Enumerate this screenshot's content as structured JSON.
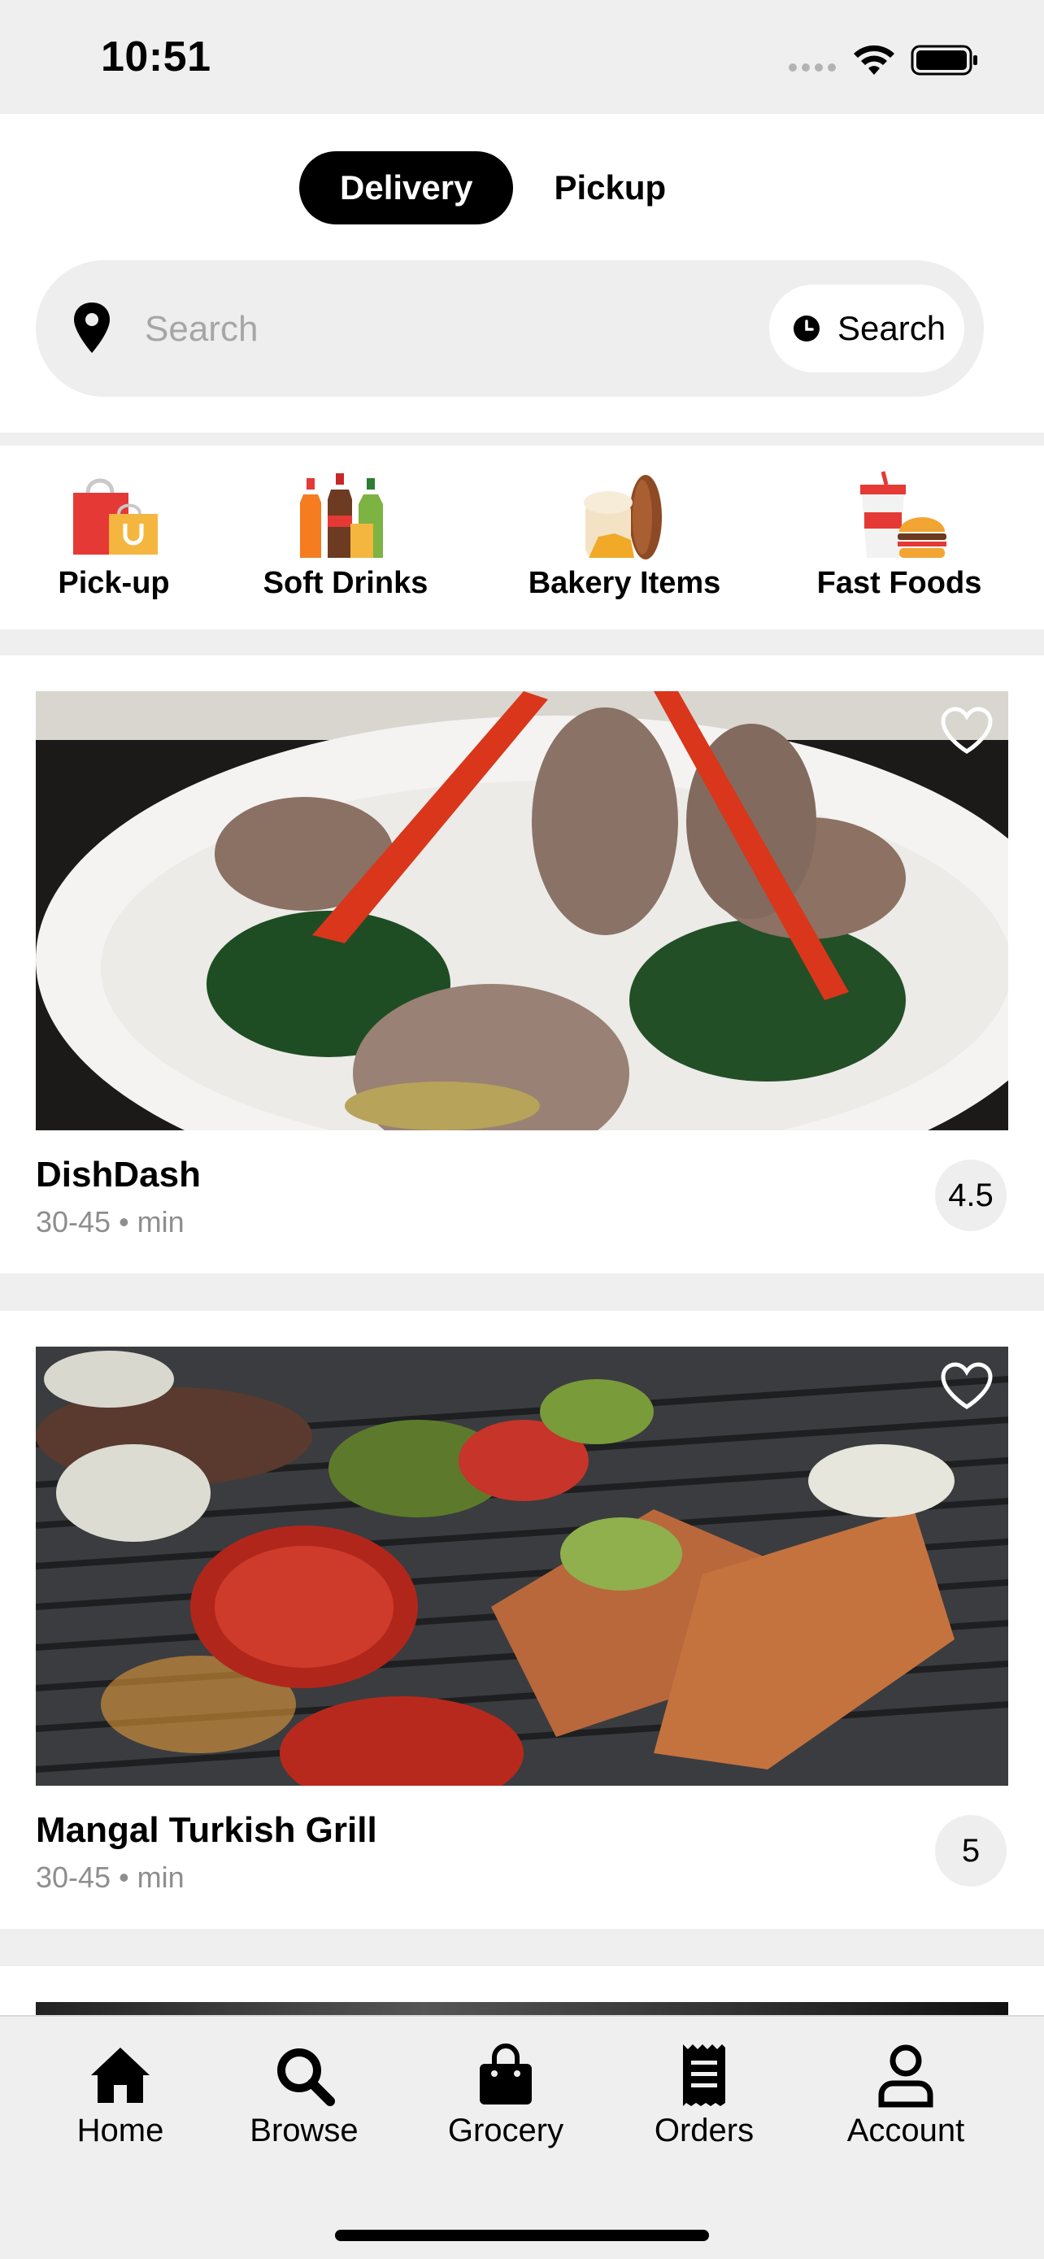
{
  "status_bar": {
    "time": "10:51"
  },
  "mode_toggle": {
    "delivery_label": "Delivery",
    "pickup_label": "Pickup",
    "active": "Delivery"
  },
  "search": {
    "placeholder": "Search",
    "button_label": "Search"
  },
  "categories": [
    {
      "label": "Pick-up",
      "icon": "shopping-bags-icon"
    },
    {
      "label": "Soft Drinks",
      "icon": "soda-bottles-icon"
    },
    {
      "label": "Bakery Items",
      "icon": "bread-icon"
    },
    {
      "label": "Fast Foods",
      "icon": "burger-drink-icon"
    }
  ],
  "restaurants": [
    {
      "name": "DishDash",
      "time": "30-45 • min",
      "rating": "4.5",
      "image": "grilled lamb chops with red peppers and spinach"
    },
    {
      "name": "Mangal Turkish Grill",
      "time": "30-45 • min",
      "rating": "5",
      "image": "kebab skewers, tomatoes and peppers on grill"
    }
  ],
  "tab_bar": [
    {
      "label": "Home",
      "icon": "home-icon"
    },
    {
      "label": "Browse",
      "icon": "search-icon"
    },
    {
      "label": "Grocery",
      "icon": "shopping-bag-icon"
    },
    {
      "label": "Orders",
      "icon": "receipt-icon"
    },
    {
      "label": "Account",
      "icon": "person-icon"
    }
  ],
  "colors": {
    "accent": "#000000",
    "background": "#efefef",
    "muted_text": "#8e8e8e"
  }
}
